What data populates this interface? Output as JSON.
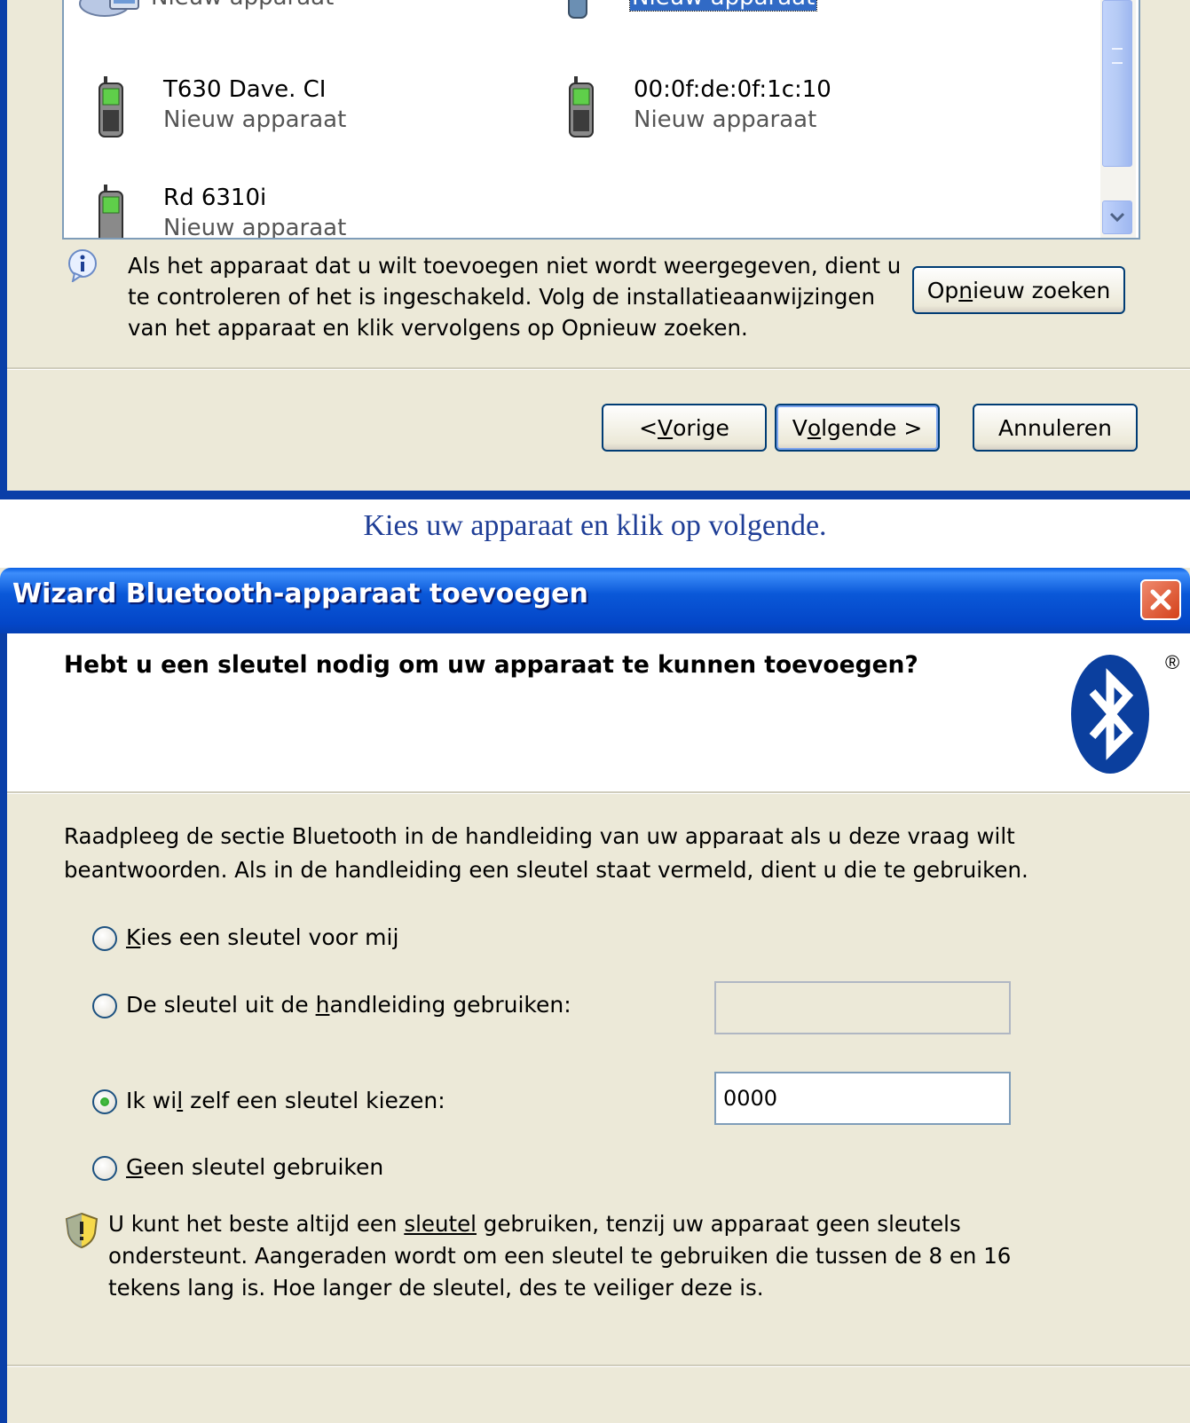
{
  "top_dialog": {
    "devices": [
      {
        "name": "",
        "status": "Nieuw apparaat",
        "icon": "computer-icon",
        "selected": false
      },
      {
        "name": "",
        "status": "Nieuw apparaat",
        "icon": "phone-icon",
        "selected": true
      },
      {
        "name": "T630  Dave. CI",
        "status": "Nieuw apparaat",
        "icon": "phone-icon",
        "selected": false
      },
      {
        "name": "00:0f:de:0f:1c:10",
        "status": "Nieuw apparaat",
        "icon": "phone-icon",
        "selected": false
      },
      {
        "name": "Rd 6310i",
        "status": "Nieuw apparaat",
        "icon": "phone-icon",
        "selected": false
      }
    ],
    "info_text": "Als het apparaat dat u wilt toevoegen niet wordt weergegeven, dient u te controleren of het is ingeschakeld. Volg de installatieaanwijzingen van het apparaat en klik vervolgens op Opnieuw zoeken.",
    "rescan_button": {
      "pre": "Op",
      "accel": "n",
      "post": "ieuw zoeken"
    },
    "back_button": {
      "pre": "< ",
      "accel": "V",
      "post": "orige"
    },
    "next_button": {
      "pre": "V",
      "accel": "o",
      "post": "lgende >"
    },
    "cancel_button": "Annuleren"
  },
  "caption": "Kies uw apparaat en klik op volgende.",
  "bottom_dialog": {
    "window_title": "Wizard Bluetooth-apparaat toevoegen",
    "header_title": "Hebt u een sleutel nodig om uw apparaat te kunnen toevoegen?",
    "registered_mark": "®",
    "description": "Raadpleeg de sectie Bluetooth in de handleiding van uw apparaat als u deze vraag wilt beantwoorden. Als in de handleiding een sleutel staat vermeld, dient u die te gebruiken.",
    "options": [
      {
        "pre": "",
        "accel": "K",
        "post": "ies een sleutel voor mij",
        "selected": false
      },
      {
        "pre": "De sleutel uit de ",
        "accel": "h",
        "post": "andleiding gebruiken:",
        "selected": false
      },
      {
        "pre": "Ik wi",
        "accel": "l",
        "post": " zelf een sleutel kiezen:",
        "selected": true
      },
      {
        "pre": "",
        "accel": "G",
        "post": "een sleutel gebruiken",
        "selected": false
      }
    ],
    "manual_key_value": "",
    "custom_key_value": "0000",
    "tip": {
      "before": "U kunt het beste altijd een ",
      "link": "sleutel",
      "after": " gebruiken, tenzij uw apparaat geen sleutels ondersteunt. Aangeraden wordt om een sleutel te gebruiken die tussen de 8 en 16 tekens lang is. Hoe langer de sleutel, des te veiliger deze is."
    }
  },
  "colors": {
    "dialog_bg": "#ece9d8",
    "titlebar_blue": "#0a58d8",
    "selection_blue": "#316ac5",
    "caption_blue": "#1f3e96",
    "bluetooth_blue": "#0b3f9e"
  }
}
